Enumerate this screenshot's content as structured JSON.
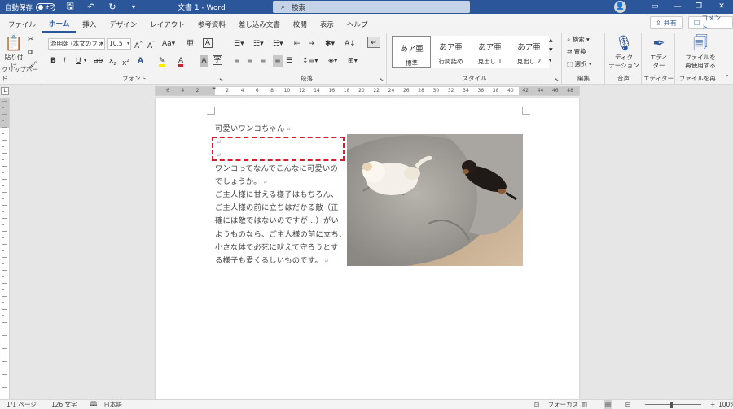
{
  "titlebar": {
    "autosave_label": "自動保存",
    "autosave_state": "オフ",
    "doc_title": "文書 1  -  Word",
    "search_placeholder": "検索",
    "user_initial": "👤"
  },
  "tabs": [
    "ファイル",
    "ホーム",
    "挿入",
    "デザイン",
    "レイアウト",
    "参考資料",
    "差し込み文書",
    "校閲",
    "表示",
    "ヘルプ"
  ],
  "active_tab": "ホーム",
  "share_label": "共有",
  "comment_label": "コメント",
  "ribbon": {
    "clipboard": {
      "paste_label": "貼り付け",
      "group_label": "クリップボード"
    },
    "font": {
      "font_name": "游明朝 (本文のフォ",
      "font_size": "10.5",
      "group_label": "フォント",
      "aa_label": "Aa"
    },
    "paragraph": {
      "group_label": "段落"
    },
    "styles": {
      "group_label": "スタイル",
      "items": [
        {
          "sample": "あア亜",
          "name": "標準"
        },
        {
          "sample": "あア亜",
          "name": "行間詰め"
        },
        {
          "sample": "あア亜",
          "name": "見出し 1"
        },
        {
          "sample": "あア亜",
          "name": "見出し 2"
        }
      ]
    },
    "editing": {
      "group_label": "編集",
      "find": "検索",
      "replace": "置換",
      "select": "選択"
    },
    "voice": {
      "group_label": "音声",
      "dictate": "ディク\nテーション"
    },
    "editor": {
      "group_label": "エディター",
      "label": "エディ\nター"
    },
    "reuse": {
      "group_label": "ファイルを再…",
      "label": "ファイルを\n再使用する"
    }
  },
  "ruler": {
    "ticks": [
      "6",
      "4",
      "2",
      "",
      "2",
      "4",
      "6",
      "8",
      "10",
      "12",
      "14",
      "16",
      "18",
      "20",
      "22",
      "24",
      "26",
      "28",
      "30",
      "32",
      "34",
      "36",
      "38",
      "40",
      "42",
      "44",
      "46",
      "48"
    ]
  },
  "document": {
    "lines": [
      "可愛いワンコちゃん",
      "",
      "",
      "ワンコってなんでこんなに可愛いの",
      "でしょうか。",
      "ご主人様に甘える様子はもちろん、",
      "ご主人様の前に立ちはだかる敵（正",
      "確には敵ではないのですが…）がい",
      "ようものなら、ご主人様の前に立ち、",
      "小さな体で必死に吠えて守ろうとす",
      "る様子も愛くるしいものです。"
    ],
    "paragraph_mark": "↵"
  },
  "statusbar": {
    "page": "1/1 ページ",
    "words": "126 文字",
    "language": "日本語",
    "focus": "フォーカス",
    "zoom": "100%"
  },
  "colors": {
    "accent": "#2b579a",
    "highlight": "#d5202a"
  }
}
